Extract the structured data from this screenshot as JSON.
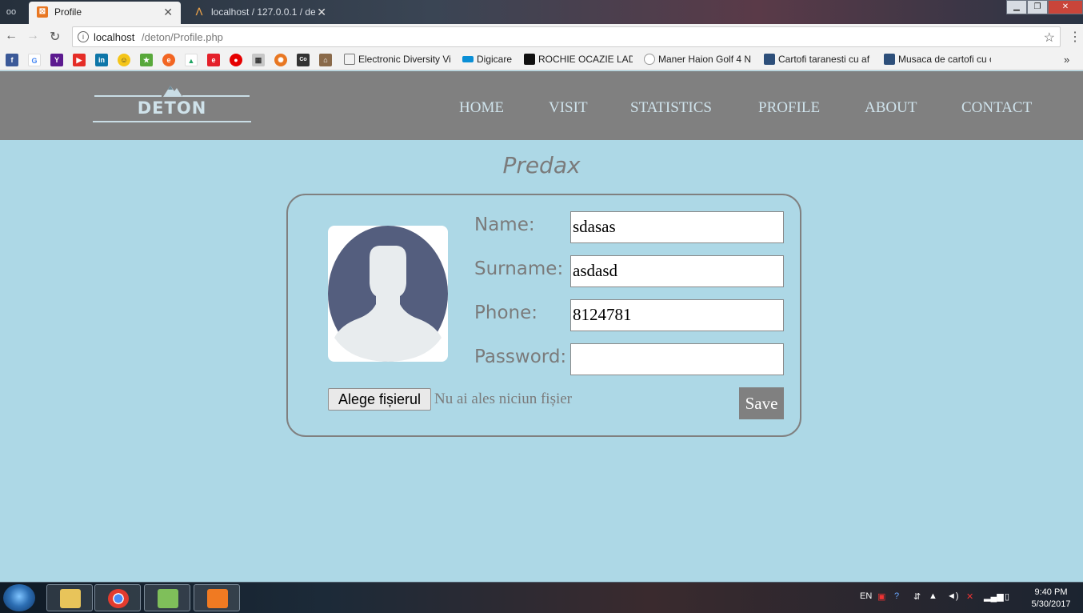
{
  "browser": {
    "tabs": [
      {
        "title": "Profile",
        "favicon": "xampp-icon",
        "active": true
      },
      {
        "title": "localhost / 127.0.0.1 / de",
        "favicon": "phpmyadmin-icon",
        "active": false
      }
    ],
    "address": {
      "host": "localhost",
      "path": "/deton/Profile.php"
    },
    "bookmarks": [
      {
        "label": "Electronic Diversity Vi",
        "icon": "page-icon"
      },
      {
        "label": "Digicare",
        "icon": "digicare-icon"
      },
      {
        "label": "ROCHIE OCAZIE LADY",
        "icon": "tf-icon"
      },
      {
        "label": "Maner Haion Golf 4 N",
        "icon": "olx-icon"
      },
      {
        "label": "Cartofi taranesti cu af",
        "icon": "cartofi-icon"
      },
      {
        "label": "Musaca de cartofi cu c",
        "icon": "musaca-icon"
      }
    ]
  },
  "site": {
    "logo_text": "DETON",
    "nav": [
      "HOME",
      "VISIT",
      "STATISTICS",
      "PROFILE",
      "ABOUT",
      "CONTACT"
    ]
  },
  "profile": {
    "username": "Predax",
    "fields": [
      {
        "label": "Name:",
        "value": "sdasas"
      },
      {
        "label": "Surname:",
        "value": "asdasd"
      },
      {
        "label": "Phone:",
        "value": "8124781"
      },
      {
        "label": "Password:",
        "value": ""
      }
    ],
    "file_button": "Alege fișierul",
    "file_status": "Nu ai ales niciun fișier",
    "save_label": "Save"
  },
  "taskbar": {
    "language": "EN",
    "time": "9:40 PM",
    "date": "5/30/2017"
  },
  "colors": {
    "page_bg": "#add8e6",
    "header_bg": "#808080",
    "nav_text": "#cfe3ec",
    "avatar_body": "#545e7e",
    "avatar_figure": "#e8ecee"
  }
}
